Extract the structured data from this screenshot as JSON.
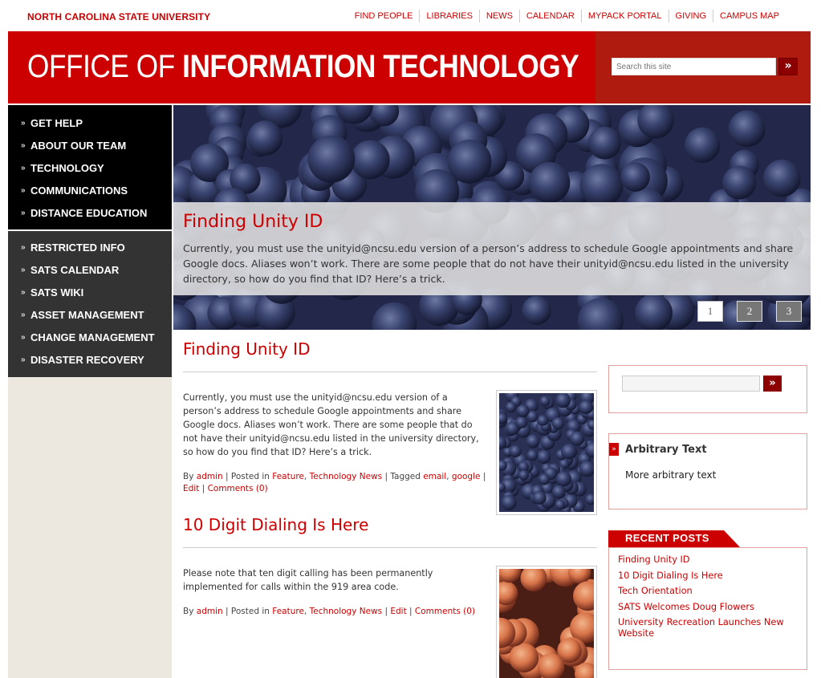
{
  "top": {
    "university": "NORTH CAROLINA STATE UNIVERSITY",
    "links": [
      "FIND PEOPLE",
      "LIBRARIES",
      "NEWS",
      "CALENDAR",
      "MYPACK PORTAL",
      "GIVING",
      "CAMPUS MAP"
    ]
  },
  "header": {
    "title_light": "OFFICE OF ",
    "title_bold": "INFORMATION TECHNOLOGY",
    "search_placeholder": "Search this site",
    "search_button": "»"
  },
  "nav": {
    "primary": [
      "GET HELP",
      "ABOUT OUR TEAM",
      "TECHNOLOGY",
      "COMMUNICATIONS",
      "DISTANCE EDUCATION"
    ],
    "secondary": [
      "RESTRICTED INFO",
      "SATS CALENDAR",
      "SATS WIKI",
      "ASSET MANAGEMENT",
      "CHANGE MANAGEMENT",
      "DISASTER RECOVERY"
    ],
    "chevron": "»"
  },
  "feature": {
    "title": "Finding Unity ID",
    "text": "Currently, you must use the unityid@ncsu.edu version of a person’s address to schedule Google appointments and share Google docs. Aliases won’t work. There are some people that do not have their unityid@ncsu.edu listed in the university directory, so how do you find that ID? Here’s a trick.",
    "pages": [
      "1",
      "2",
      "3"
    ],
    "active_page": 1
  },
  "posts": [
    {
      "title": "Finding Unity ID",
      "body": "Currently, you must use the unityid@ncsu.edu version of a person’s address to schedule Google appointments and share Google docs. Aliases won’t work. There are some people that do not have their unityid@ncsu.edu listed in the university directory, so how do you find that ID? Here’s a trick.",
      "by": "By ",
      "author": "admin",
      "posted_in": " | Posted in ",
      "cat1": "Feature",
      "cat_sep": ", ",
      "cat2": "Technology News",
      "tagged": " | Tagged ",
      "tag1": "email",
      "tag2": "google",
      "sep": " | ",
      "edit": "Edit",
      "comments": "Comments (0)"
    },
    {
      "title": "10 Digit Dialing Is Here",
      "body": "Please note that ten digit calling has been permanently implemented  for calls within the 919 area code.",
      "by": "By ",
      "author": "admin",
      "posted_in": " | Posted in ",
      "cat1": "Feature",
      "cat_sep": ", ",
      "cat2": "Technology News",
      "sep": " | ",
      "edit": "Edit",
      "comments": "Comments (0)"
    }
  ],
  "sidebar": {
    "search_button": "»",
    "arbitrary_title": "Arbitrary Text",
    "arbitrary_body": "More arbitrary text",
    "marker": "»",
    "recent_title": "RECENT POSTS",
    "recent": [
      "Finding Unity ID",
      "10 Digit Dialing Is Here",
      "Tech Orientation",
      "SATS Welcomes Doug Flowers",
      "University Recreation Launches New Website"
    ]
  },
  "colors": {
    "brand": "#cc0000",
    "header_dark": "#b01b10",
    "nav_black": "#000000",
    "nav_gray": "#333333"
  }
}
